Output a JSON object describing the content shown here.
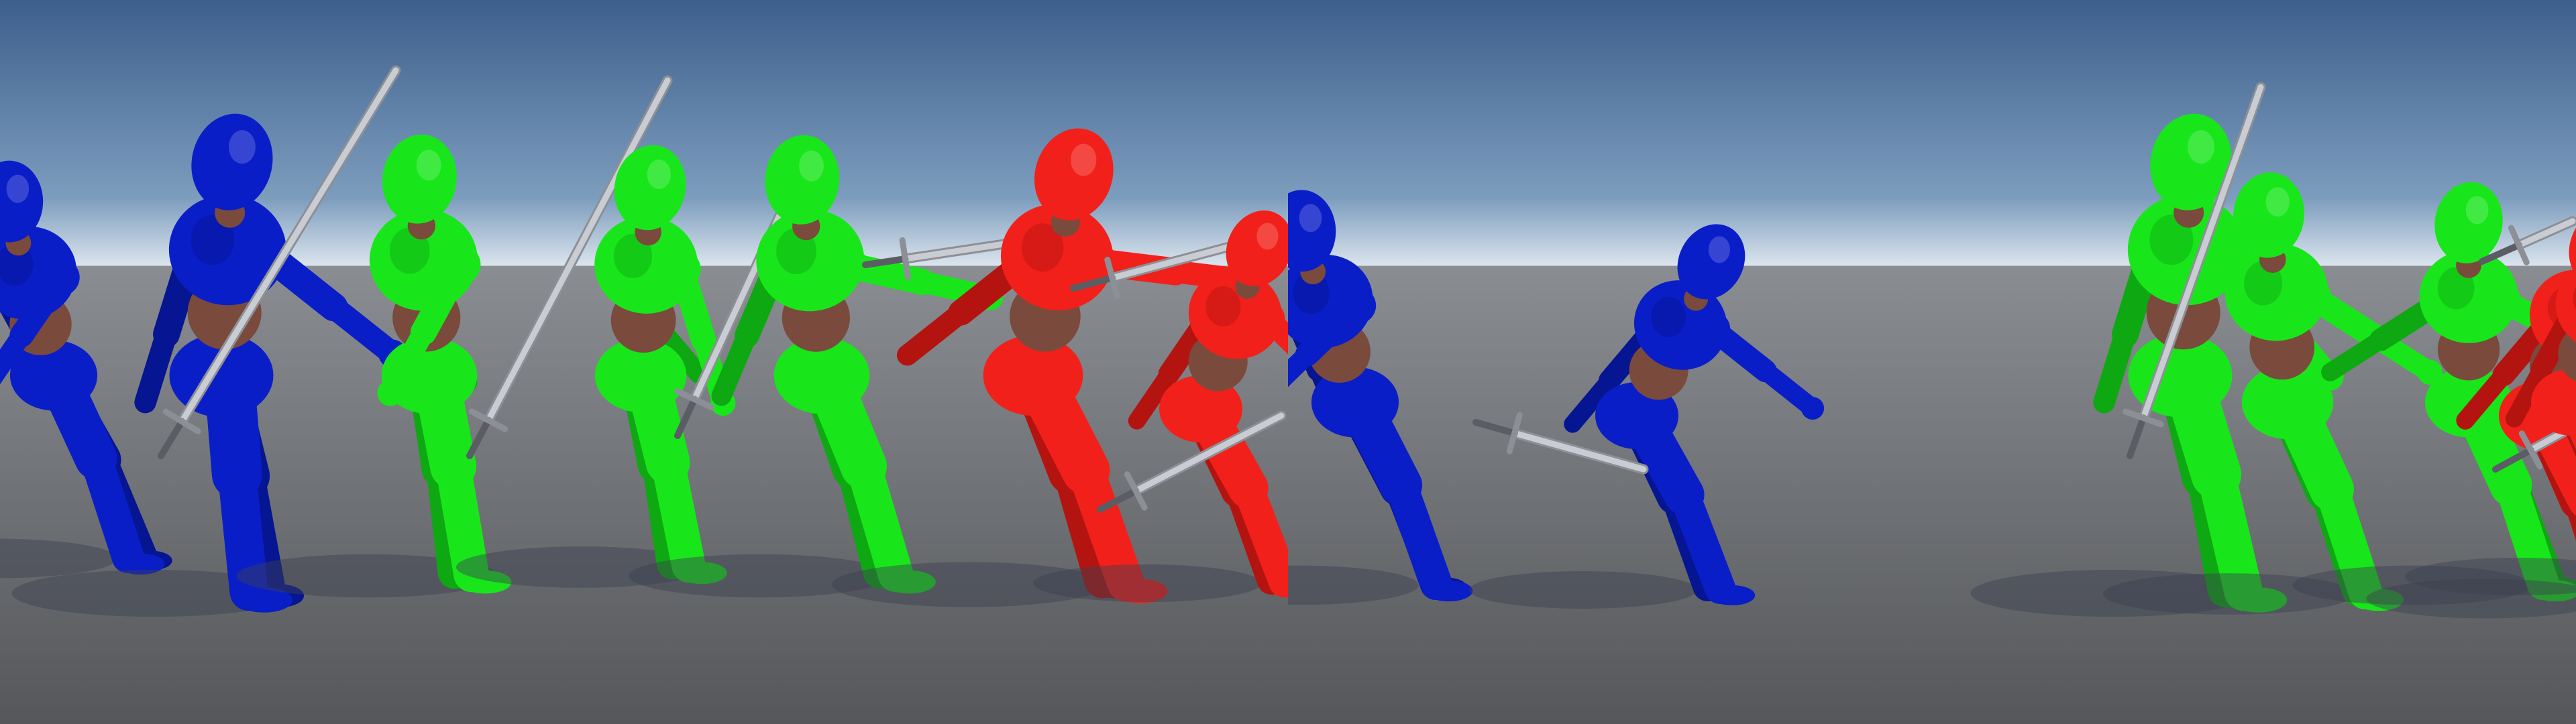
{
  "scene": {
    "colors": {
      "sky_top": "#3d5f8c",
      "sky_mid": "#7d9dbe",
      "horizon": "#d9e3ec",
      "ground_near": "#55575a",
      "ground_far": "#8a8d92",
      "shadow": "#3b4150",
      "team_blue": "#0a1ec8",
      "team_blue_dark": "#061591",
      "team_green": "#18e61a",
      "team_green_dark": "#0ea812",
      "team_red": "#f2201a",
      "team_red_dark": "#b31410",
      "joint": "#7a4a3c",
      "sword_blade": "#c9cdd3",
      "sword_edge": "#8c9096",
      "sword_hilt": "#5a5e64"
    },
    "views": [
      {
        "name": "camera-view-left",
        "characters": [
          {
            "team": "blue",
            "weapon": "none"
          },
          {
            "team": "blue",
            "weapon": "sword"
          },
          {
            "team": "green",
            "weapon": "sword"
          },
          {
            "team": "green",
            "weapon": "sword"
          },
          {
            "team": "green",
            "weapon": "sword"
          },
          {
            "team": "red",
            "weapon": "sword"
          },
          {
            "team": "red",
            "weapon": "sword"
          }
        ]
      },
      {
        "name": "camera-view-right",
        "characters": [
          {
            "team": "blue",
            "weapon": "none"
          },
          {
            "team": "blue",
            "weapon": "sword"
          },
          {
            "team": "green",
            "weapon": "sword"
          },
          {
            "team": "green",
            "weapon": "none"
          },
          {
            "team": "green",
            "weapon": "none"
          },
          {
            "team": "red",
            "weapon": "sword"
          },
          {
            "team": "red",
            "weapon": "sword"
          }
        ]
      }
    ]
  }
}
